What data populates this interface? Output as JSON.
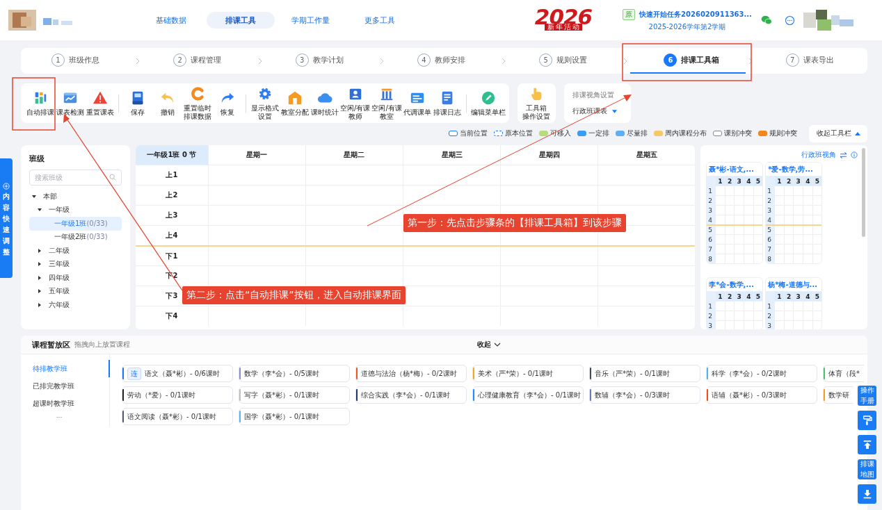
{
  "top_nav": {
    "tabs": [
      {
        "label": "基础数据",
        "selected": false
      },
      {
        "label": "排课工具",
        "selected": true
      },
      {
        "label": "学期工作量",
        "selected": false
      },
      {
        "label": "更多工具",
        "selected": false
      }
    ],
    "event_logo": {
      "year": "2026",
      "subtitle": "新年活动"
    },
    "task": {
      "badge": "原",
      "title": "快速开始任务2026020911363...",
      "term": "2025-2026学年第2学期"
    }
  },
  "steps": [
    {
      "number": "1",
      "label": "班级作息",
      "selected": false
    },
    {
      "number": "2",
      "label": "课程管理",
      "selected": false
    },
    {
      "number": "3",
      "label": "教学计划",
      "selected": false
    },
    {
      "number": "4",
      "label": "教师安排",
      "selected": false
    },
    {
      "number": "5",
      "label": "规则设置",
      "selected": false
    },
    {
      "number": "6",
      "label": "排课工具箱",
      "selected": true
    },
    {
      "number": "7",
      "label": "课表导出",
      "selected": false
    }
  ],
  "toolbar": {
    "groups": [
      [
        "自动排课",
        "课表检测",
        "重置课表"
      ],
      [
        "保存",
        "撤销",
        [
          "重置临时",
          "排课数据"
        ],
        "恢复"
      ],
      [
        [
          "显示格式",
          "设置"
        ],
        "教室分配",
        "课时统计",
        [
          "空闲/有课",
          "教师"
        ],
        [
          "空闲/有课",
          "教室"
        ],
        "代调课单",
        "排课日志"
      ],
      [
        "编辑菜单栏"
      ]
    ],
    "settings_button": [
      "工具箱",
      "操作设置"
    ],
    "view_settings": {
      "title": "排课视角设置",
      "value": "行政班课表"
    }
  },
  "legend": [
    {
      "label": "当前位置",
      "kind": "outline",
      "color": "#1677ff"
    },
    {
      "label": "原本位置",
      "kind": "dashed",
      "color": "#1677ff"
    },
    {
      "label": "可移入",
      "kind": "fill",
      "color": "#b5dd7a"
    },
    {
      "label": "一定排",
      "kind": "fill",
      "color": "#3b9cf5"
    },
    {
      "label": "尽量排",
      "kind": "fill",
      "color": "#5bb0f7"
    },
    {
      "label": "周内课程分布",
      "kind": "fill",
      "color": "#f8c66b"
    },
    {
      "label": "课别冲突",
      "kind": "outline",
      "color": "#888888"
    },
    {
      "label": "规则冲突",
      "kind": "fill",
      "color": "#f0861c"
    }
  ],
  "collapse_toolbar": "收起工具栏",
  "class_panel": {
    "title": "班级",
    "search": {
      "placeholder": "搜索班级"
    },
    "tree": [
      {
        "label": "本部",
        "expanded": true,
        "children": [
          {
            "label": "一年级",
            "expanded": true,
            "children": [
              {
                "label": "一年级1班",
                "count": "(0/33)",
                "selected": true
              },
              {
                "label": "一年级2班",
                "count": "(0/33)",
                "selected": false
              }
            ]
          },
          {
            "label": "二年级",
            "expanded": false
          },
          {
            "label": "三年级",
            "expanded": false
          },
          {
            "label": "四年级",
            "expanded": false
          },
          {
            "label": "五年级",
            "expanded": false
          },
          {
            "label": "六年级",
            "expanded": false
          }
        ]
      }
    ]
  },
  "timetable": {
    "corner": "一年级1班 0 节",
    "days": [
      "星期一",
      "星期二",
      "星期三",
      "星期四",
      "星期五"
    ],
    "sections": [
      [
        "上1",
        "上2",
        "上3",
        "上4"
      ],
      [
        "下1",
        "下2",
        "下3",
        "下4"
      ]
    ]
  },
  "teacher_panel": {
    "view_label": "行政班视角",
    "cards": [
      {
        "title": "聂*彬-语文,...",
        "days": [
          "1",
          "2",
          "3",
          "4",
          "5"
        ],
        "sections": [
          [
            "1",
            "2",
            "3",
            "4"
          ],
          [
            "5",
            "6",
            "7",
            "8"
          ]
        ]
      },
      {
        "title": "*爱-数学,劳...",
        "days": [
          "1",
          "2",
          "3",
          "4",
          "5"
        ],
        "sections": [
          [
            "1",
            "2",
            "3",
            "4"
          ],
          [
            "5",
            "6",
            "7",
            "8"
          ]
        ]
      },
      {
        "title": "李*会-数学,...",
        "days": [
          "1",
          "2",
          "3",
          "4",
          "5"
        ],
        "sections": [
          [
            "1",
            "2",
            "3"
          ]
        ]
      },
      {
        "title": "杨*梅-道德与...",
        "days": [
          "1",
          "2",
          "3",
          "4",
          "5"
        ],
        "sections": [
          [
            "1",
            "2",
            "3"
          ]
        ]
      }
    ]
  },
  "course_pool": {
    "title": "课程暂放区",
    "hint": "拖拽向上放置课程",
    "collapse": "收起",
    "tabs": [
      {
        "label": "待排教学班",
        "selected": true
      },
      {
        "label": "已排完教学班",
        "selected": false
      },
      {
        "label": "超课时教学班",
        "selected": false
      }
    ],
    "more": "...",
    "courses": [
      {
        "text": "语文（聂*彬）- 0/6课时",
        "color": "#1677ff",
        "tag": "连"
      },
      {
        "text": "数学（李*会）- 0/5课时",
        "color": "#8c8fc9"
      },
      {
        "text": "道德与法治（杨*梅）- 0/2课时",
        "color": "#f5541c"
      },
      {
        "text": "美术（严*荣）- 0/1课时",
        "color": "#f5a623"
      },
      {
        "text": "音乐（严*荣）- 0/1课时",
        "color": "#444a5a"
      },
      {
        "text": "科学（李*会）- 0/2课时",
        "color": "#4fb3f5"
      },
      {
        "text": "体育（段*",
        "color": "#49c26a"
      },
      {
        "text": "劳动（*爱）- 0/1课时",
        "color": "#222222"
      },
      {
        "text": "写字（聂*彬）- 0/1课时",
        "color": "#c0c0c0"
      },
      {
        "text": "综合实践（李*会）- 0/1课时",
        "color": "#1a3a6b"
      },
      {
        "text": "心理健康教育（李*会）- 0/1课时",
        "color": "#1e90ff"
      },
      {
        "text": "数辅（李*会）- 0/3课时",
        "color": "#6b7bb8"
      },
      {
        "text": "语辅（聂*彬）- 0/3课时",
        "color": "#f24e1e"
      },
      {
        "text": "数学研",
        "color": "#f5a020"
      },
      {
        "text": "语文阅读（聂*彬）- 0/1课时",
        "color": "#555a6e"
      },
      {
        "text": "国学（聂*彬）- 0/1课时",
        "color": "#5ab4f5"
      }
    ]
  },
  "side_tab": {
    "label": "内容快速调整"
  },
  "float_buttons": [
    {
      "kind": "text",
      "label": "操作手册"
    },
    {
      "kind": "icon"
    },
    {
      "kind": "icon"
    },
    {
      "kind": "text",
      "label": "排课地图"
    },
    {
      "kind": "icon"
    }
  ],
  "annotations": [
    {
      "text": "第一步：先点击步骤条的【排课工具箱】到该步骤"
    },
    {
      "text": "第二步：点击“自动排课”按钮，进入自动排课界面"
    }
  ]
}
